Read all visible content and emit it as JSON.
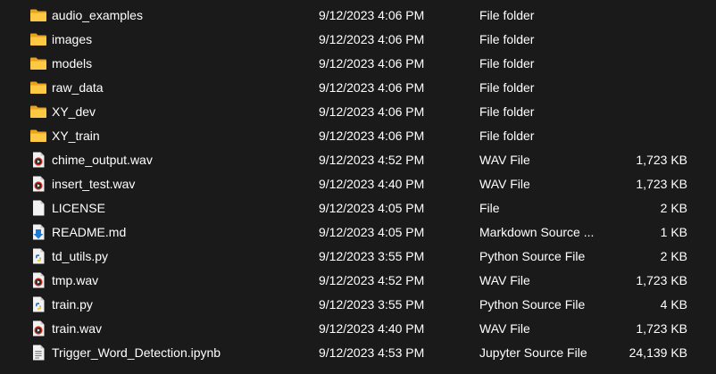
{
  "files": [
    {
      "name": "audio_examples",
      "date": "9/12/2023 4:06 PM",
      "type": "File folder",
      "size": "",
      "icon": "folder-icon"
    },
    {
      "name": "images",
      "date": "9/12/2023 4:06 PM",
      "type": "File folder",
      "size": "",
      "icon": "folder-icon"
    },
    {
      "name": "models",
      "date": "9/12/2023 4:06 PM",
      "type": "File folder",
      "size": "",
      "icon": "folder-icon"
    },
    {
      "name": "raw_data",
      "date": "9/12/2023 4:06 PM",
      "type": "File folder",
      "size": "",
      "icon": "folder-icon"
    },
    {
      "name": "XY_dev",
      "date": "9/12/2023 4:06 PM",
      "type": "File folder",
      "size": "",
      "icon": "folder-icon"
    },
    {
      "name": "XY_train",
      "date": "9/12/2023 4:06 PM",
      "type": "File folder",
      "size": "",
      "icon": "folder-icon"
    },
    {
      "name": "chime_output.wav",
      "date": "9/12/2023 4:52 PM",
      "type": "WAV File",
      "size": "1,723 KB",
      "icon": "wav-file-icon"
    },
    {
      "name": "insert_test.wav",
      "date": "9/12/2023 4:40 PM",
      "type": "WAV File",
      "size": "1,723 KB",
      "icon": "wav-file-icon"
    },
    {
      "name": "LICENSE",
      "date": "9/12/2023 4:05 PM",
      "type": "File",
      "size": "2 KB",
      "icon": "blank-file-icon"
    },
    {
      "name": "README.md",
      "date": "9/12/2023 4:05 PM",
      "type": "Markdown Source ...",
      "size": "1 KB",
      "icon": "markdown-file-icon"
    },
    {
      "name": "td_utils.py",
      "date": "9/12/2023 3:55 PM",
      "type": "Python Source File",
      "size": "2 KB",
      "icon": "python-file-icon"
    },
    {
      "name": "tmp.wav",
      "date": "9/12/2023 4:52 PM",
      "type": "WAV File",
      "size": "1,723 KB",
      "icon": "wav-file-icon"
    },
    {
      "name": "train.py",
      "date": "9/12/2023 3:55 PM",
      "type": "Python Source File",
      "size": "4 KB",
      "icon": "python-file-icon"
    },
    {
      "name": "train.wav",
      "date": "9/12/2023 4:40 PM",
      "type": "WAV File",
      "size": "1,723 KB",
      "icon": "wav-file-icon"
    },
    {
      "name": "Trigger_Word_Detection.ipynb",
      "date": "9/12/2023 4:53 PM",
      "type": "Jupyter Source File",
      "size": "24,139 KB",
      "icon": "notebook-file-icon"
    }
  ]
}
